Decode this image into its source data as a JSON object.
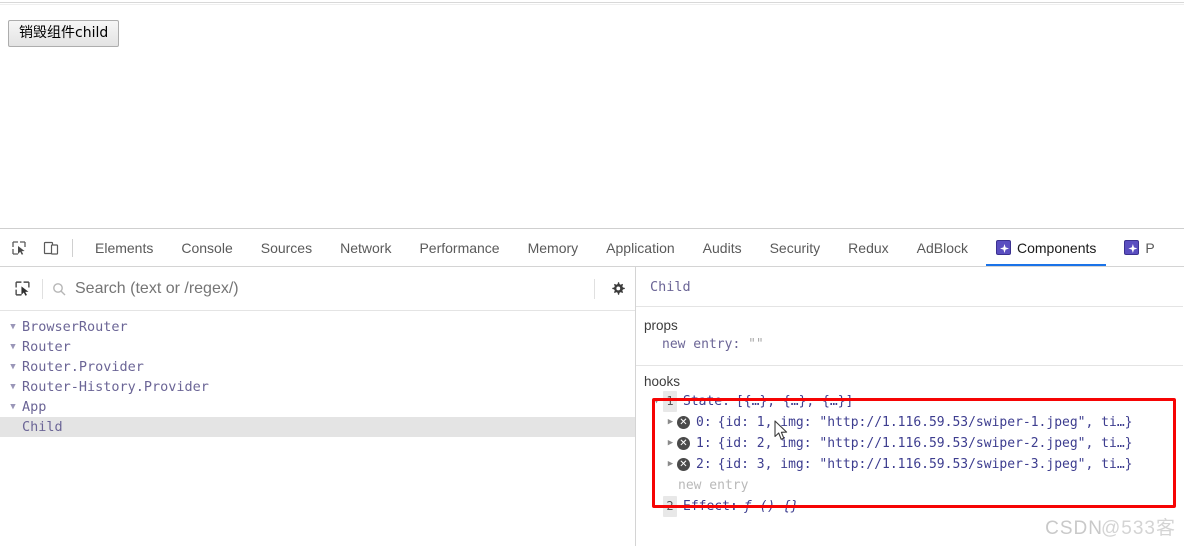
{
  "page": {
    "destroy_button_label": "销毁组件child"
  },
  "devtools": {
    "toolbar_icons": [
      {
        "name": "inspect-element-icon",
        "glyph": "inspect"
      },
      {
        "name": "device-toolbar-icon",
        "glyph": "device"
      }
    ],
    "tabs": [
      {
        "label": "Elements",
        "active": false,
        "icon": null
      },
      {
        "label": "Console",
        "active": false,
        "icon": null
      },
      {
        "label": "Sources",
        "active": false,
        "icon": null
      },
      {
        "label": "Network",
        "active": false,
        "icon": null
      },
      {
        "label": "Performance",
        "active": false,
        "icon": null
      },
      {
        "label": "Memory",
        "active": false,
        "icon": null
      },
      {
        "label": "Application",
        "active": false,
        "icon": null
      },
      {
        "label": "Audits",
        "active": false,
        "icon": null
      },
      {
        "label": "Security",
        "active": false,
        "icon": null
      },
      {
        "label": "Redux",
        "active": false,
        "icon": null
      },
      {
        "label": "AdBlock",
        "active": false,
        "icon": null
      },
      {
        "label": "Components",
        "active": true,
        "icon": "react-icon"
      },
      {
        "label": "P",
        "active": false,
        "icon": "react-icon"
      }
    ]
  },
  "components_panel": {
    "search": {
      "placeholder": "Search (text or /regex/)",
      "value": ""
    },
    "icons": {
      "select_component": "crosshair-select-icon",
      "search": "search-icon",
      "settings": "gear-icon"
    },
    "tree": [
      {
        "label": "BrowserRouter",
        "depth": 0,
        "expanded": true,
        "selected": false
      },
      {
        "label": "Router",
        "depth": 0,
        "expanded": true,
        "selected": false
      },
      {
        "label": "Router.Provider",
        "depth": 0,
        "expanded": true,
        "selected": false
      },
      {
        "label": "Router-History.Provider",
        "depth": 0,
        "expanded": true,
        "selected": false
      },
      {
        "label": "App",
        "depth": 0,
        "expanded": true,
        "selected": false
      },
      {
        "label": "Child",
        "depth": 1,
        "expanded": false,
        "selected": true
      }
    ]
  },
  "detail_panel": {
    "component_name": "Child",
    "props": {
      "title": "props",
      "entries": [
        {
          "key": "new entry:",
          "value": "\"\""
        }
      ]
    },
    "hooks": {
      "title": "hooks",
      "items": [
        {
          "index": "1",
          "name": "State:",
          "value": "[{…}, {…}, {…}]",
          "expanded": true,
          "children": [
            {
              "key": "0:",
              "value": "{id: 1, img: \"http://1.116.59.53/swiper-1.jpeg\", ti…}"
            },
            {
              "key": "1:",
              "value": "{id: 2, img: \"http://1.116.59.53/swiper-2.jpeg\", ti…}"
            },
            {
              "key": "2:",
              "value": "{id: 3, img: \"http://1.116.59.53/swiper-3.jpeg\", ti…}"
            }
          ],
          "trailing_label": "new entry"
        },
        {
          "index": "2",
          "name": "Effect:",
          "value": "ƒ () {}",
          "expanded": false,
          "children": [],
          "trailing_label": ""
        }
      ]
    }
  },
  "annotation": {
    "highlight_color": "#f60404"
  },
  "watermark": {
    "text_primary": "CSDN",
    "text_secondary": "@533客"
  }
}
